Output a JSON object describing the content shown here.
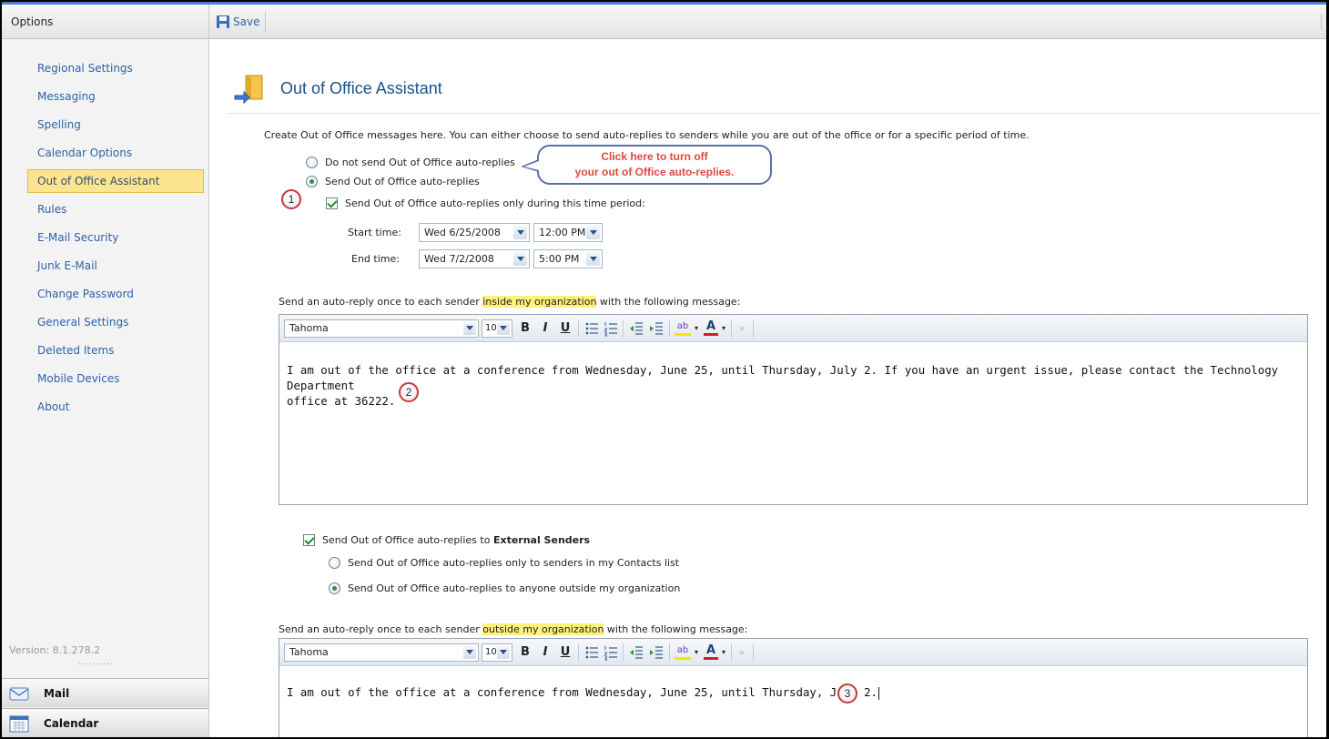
{
  "sidebar": {
    "header": "Options",
    "items": [
      {
        "label": "Regional Settings"
      },
      {
        "label": "Messaging"
      },
      {
        "label": "Spelling"
      },
      {
        "label": "Calendar Options"
      },
      {
        "label": "Out of Office Assistant",
        "selected": true
      },
      {
        "label": "Rules"
      },
      {
        "label": "E-Mail Security"
      },
      {
        "label": "Junk E-Mail"
      },
      {
        "label": "Change Password"
      },
      {
        "label": "General Settings"
      },
      {
        "label": "Deleted Items"
      },
      {
        "label": "Mobile Devices"
      },
      {
        "label": "About"
      }
    ],
    "version": "Version: 8.1.278.2",
    "dots": "..........",
    "mail_label": "Mail",
    "calendar_label": "Calendar"
  },
  "toolbar": {
    "save_label": "Save"
  },
  "page": {
    "title": "Out of Office Assistant",
    "intro": "Create Out of Office messages here. You can either choose to send auto-replies to senders while you are out of the office or for a specific period of time.",
    "radio_off_label": "Do not send Out of Office auto-replies",
    "radio_on_label": "Send Out of Office auto-replies",
    "period_check_label": "Send Out of Office auto-replies only during this time period:",
    "start_label": "Start time:",
    "end_label": "End time:",
    "start_date": "Wed 6/25/2008",
    "start_time": "12:00 PM",
    "end_date": "Wed 7/2/2008",
    "end_time": "5:00 PM",
    "internal_prefix": "Send an auto-reply once to each sender ",
    "internal_highlight": "inside my organization",
    "internal_suffix": " with the following message:",
    "internal_message_line1": "I am out of the office at a conference from Wednesday, June 25, until Thursday, July 2.  If you have an urgent issue, please contact the Technology Department",
    "internal_message_line2": "office at 36222.",
    "external_check_prefix": "Send Out of Office auto-replies to ",
    "external_check_bold": "External Senders",
    "external_radio_contacts": "Send Out of Office auto-replies only to senders in my Contacts list",
    "external_radio_anyone": "Send Out of Office auto-replies to anyone outside my organization",
    "external_prefix": "Send an auto-reply once to each sender ",
    "external_highlight": "outside my organization",
    "external_suffix": " with the following message:",
    "external_message": "I am out of the office at a conference from Wednesday, June 25, until Thursday, July 2."
  },
  "editor": {
    "font": "Tahoma",
    "size": "10",
    "bold": "B",
    "italic": "I",
    "underline": "U",
    "highlight_glyph": "ab",
    "font_color_glyph": "A",
    "overflow_glyph": "»"
  },
  "callout": {
    "line1": "Click here to turn off",
    "line2": "your out of Office auto-replies."
  },
  "markers": {
    "m1": "1",
    "m2": "2",
    "m3": "3"
  },
  "colors": {
    "accent": "#1d4f8f",
    "link": "#2e62a8",
    "selected_bg": "#fde58f",
    "highlight": "#fff27a",
    "callout_text": "#e0483f"
  }
}
